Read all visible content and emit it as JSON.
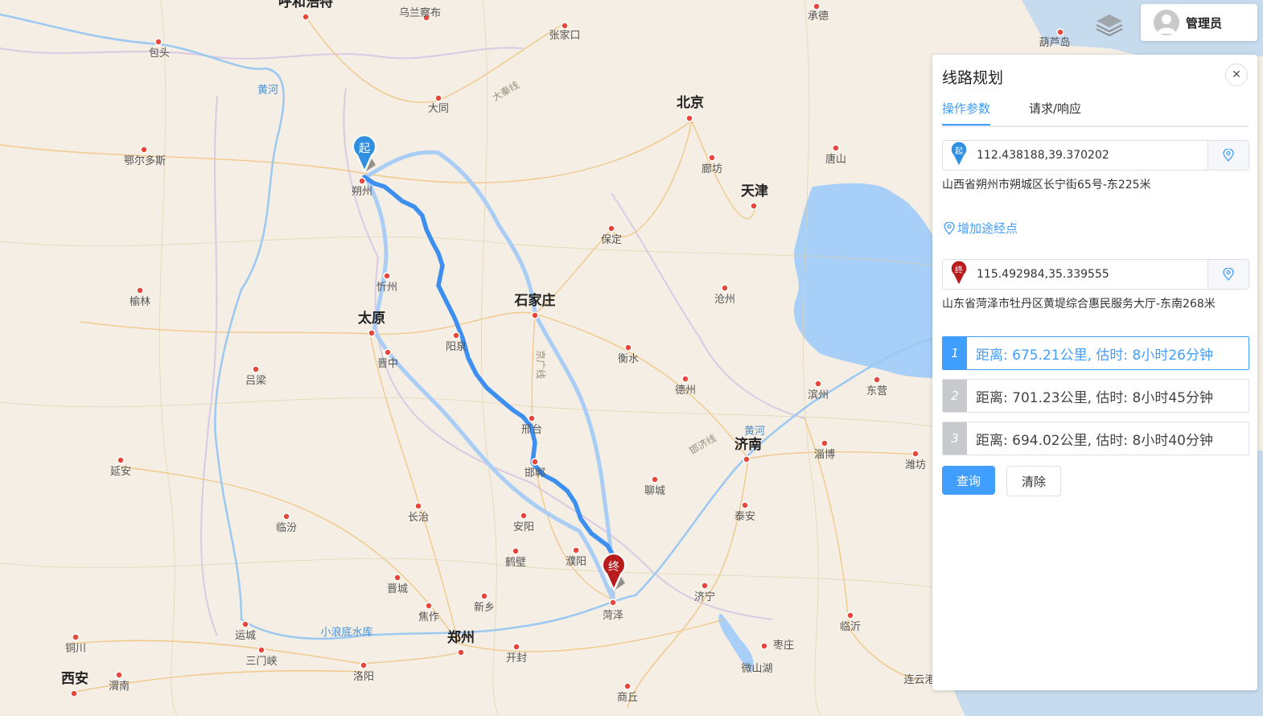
{
  "map": {
    "cities_major": [
      "北京",
      "天津",
      "石家庄",
      "太原",
      "济南",
      "郑州",
      "西安",
      "呼和浩特"
    ],
    "cities": [
      "乌兰察布",
      "承德",
      "张家口",
      "包头",
      "葫芦岛",
      "大同",
      "鄂尔多斯",
      "朔州",
      "廊坊",
      "唐山",
      "保定",
      "忻州",
      "沧州",
      "榆林",
      "阳泉",
      "衡水",
      "晋中",
      "德州",
      "吕梁",
      "邢台",
      "滨州",
      "东营",
      "延安",
      "邯郸",
      "淄博",
      "潍坊",
      "聊城",
      "长治",
      "临汾",
      "安阳",
      "泰安",
      "鹤壁",
      "濮阳",
      "晋城",
      "菏泽",
      "新乡",
      "焦作",
      "济宁",
      "临沂",
      "运城",
      "铜川",
      "三门峡",
      "枣庄",
      "开封",
      "微山湖",
      "洛阳",
      "渭南",
      "连云港",
      "商丘"
    ],
    "water_labels": [
      "黄河",
      "小浪底水库"
    ],
    "road_labels": [
      "大秦线",
      "京广线",
      "邯济线"
    ],
    "start_marker": "起",
    "end_marker": "终"
  },
  "user": {
    "name": "管理员"
  },
  "panel": {
    "title": "线路规划",
    "tabs": [
      {
        "label": "操作参数",
        "active": true
      },
      {
        "label": "请求/响应",
        "active": false
      }
    ],
    "start": {
      "marker": "起",
      "coords": "112.438188,39.370202",
      "address": "山西省朔州市朔城区长宁街65号-东225米"
    },
    "add_waypoint_label": "增加途经点",
    "end": {
      "marker": "终",
      "coords": "115.492984,35.339555",
      "address": "山东省菏泽市牡丹区黄堤综合惠民服务大厅-东南268米"
    },
    "routes": [
      {
        "index": "1",
        "text": "距离: 675.21公里, 估时: 8小时26分钟",
        "active": true
      },
      {
        "index": "2",
        "text": "距离: 701.23公里, 估时: 8小时45分钟",
        "active": false
      },
      {
        "index": "3",
        "text": "距离: 694.02公里, 估时: 8小时40分钟",
        "active": false
      }
    ],
    "query_label": "查询",
    "clear_label": "清除"
  },
  "colors": {
    "accent": "#409eff",
    "route_main": "#3d8ff0",
    "route_alt": "#a9cdf5",
    "start_marker": "#2f8fe0",
    "end_marker": "#b81c1c",
    "sea": "#a8cff7"
  }
}
